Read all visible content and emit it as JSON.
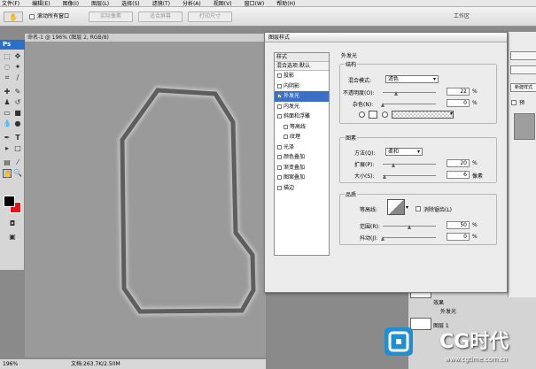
{
  "menu": {
    "items": [
      "文件(F)",
      "编辑(E)",
      "图像(I)",
      "图层(L)",
      "选择(S)",
      "滤镜(T)",
      "分析(A)",
      "视图(V)",
      "窗口(W)",
      "帮助(H)"
    ]
  },
  "options_bar": {
    "scroll_all_windows": "滚动所有窗口",
    "actual_pixels": "实际像素",
    "fit_screen": "适合屏幕",
    "print_size": "打印尺寸",
    "workspace": "工作区"
  },
  "toolbox": {
    "logo": "Ps"
  },
  "document": {
    "title": "命名-1 @ 196% (图层 2, RGB/8)",
    "zoom": "196%",
    "doc_size": "文档:263.7K/2.50M"
  },
  "dialog": {
    "title": "图层样式",
    "styles_header": "样式",
    "blend_header": "混合选项:默认",
    "styles": [
      {
        "label": "投影",
        "checked": false,
        "selected": false,
        "sub": false
      },
      {
        "label": "内阴影",
        "checked": false,
        "selected": false,
        "sub": false
      },
      {
        "label": "外发光",
        "checked": true,
        "selected": true,
        "sub": false
      },
      {
        "label": "内发光",
        "checked": false,
        "selected": false,
        "sub": false
      },
      {
        "label": "斜面和浮雕",
        "checked": false,
        "selected": false,
        "sub": false
      },
      {
        "label": "等高线",
        "checked": false,
        "selected": false,
        "sub": true
      },
      {
        "label": "纹理",
        "checked": false,
        "selected": false,
        "sub": true
      },
      {
        "label": "光泽",
        "checked": false,
        "selected": false,
        "sub": false
      },
      {
        "label": "颜色叠加",
        "checked": false,
        "selected": false,
        "sub": false
      },
      {
        "label": "渐变叠加",
        "checked": false,
        "selected": false,
        "sub": false
      },
      {
        "label": "图案叠加",
        "checked": false,
        "selected": false,
        "sub": false
      },
      {
        "label": "描边",
        "checked": false,
        "selected": false,
        "sub": false
      }
    ],
    "outer_glow": {
      "section_title": "外发光",
      "structure": {
        "title": "结构",
        "blend_mode_label": "混合模式:",
        "blend_mode": "滤色",
        "opacity_label": "不透明度(O):",
        "opacity": "22",
        "noise_label": "杂色(N):",
        "noise": "0",
        "percent": "%"
      },
      "elements": {
        "title": "图素",
        "method_label": "方法(Q):",
        "method": "柔和",
        "spread_label": "扩展(P):",
        "spread": "20",
        "size_label": "大小(S):",
        "size": "6",
        "px": "像素",
        "percent": "%"
      },
      "quality": {
        "title": "品质",
        "contour_label": "等高线:",
        "antialias_label": "消除锯齿(L)",
        "range_label": "范围(R):",
        "range": "50",
        "jitter_label": "抖动(J):",
        "jitter": "0",
        "percent": "%"
      }
    }
  },
  "right_panel": {
    "new_style": "新建样式",
    "preview_label": "预"
  },
  "layers_panel": {
    "effects": "效果",
    "outer_glow": "外发光",
    "layer_name": "图层 1"
  },
  "watermark": {
    "brand": "CG时代",
    "url": "www.cgtime.com.cn"
  },
  "colors": {
    "selection": "#3b6fc7",
    "foreground": "#000000",
    "background_swatch": "#e8141d"
  }
}
